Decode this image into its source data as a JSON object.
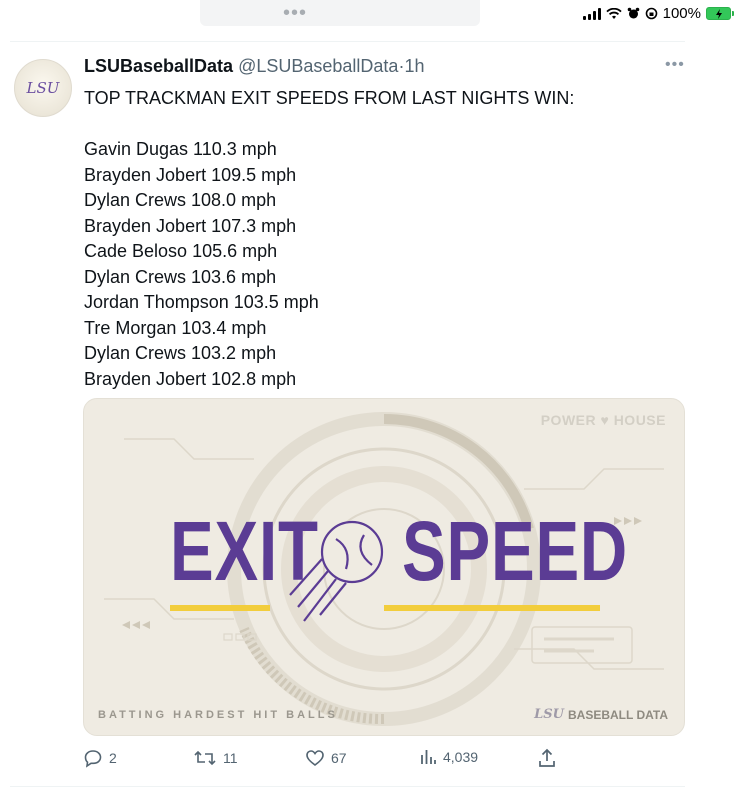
{
  "status_bar": {
    "battery_text": "100%",
    "dots": "•••",
    "colors": {
      "battery": "#33c759"
    }
  },
  "tweet": {
    "author_name": "LSUBaseballData",
    "handle": "@LSUBaseballData",
    "separator": "·",
    "time": "1h",
    "more_label": "•••",
    "avatar_text": "LSU",
    "headline": "TOP TRACKMAN EXIT SPEEDS FROM LAST NIGHTS WIN:",
    "lines": [
      "Gavin Dugas 110.3 mph",
      "Brayden Jobert 109.5 mph",
      "Dylan Crews 108.0 mph",
      "Brayden Jobert 107.3 mph",
      "Cade Beloso 105.6 mph",
      "Dylan Crews 103.6 mph",
      "Jordan Thompson 103.5 mph",
      "Tre Morgan 103.4 mph",
      "Dylan Crews 103.2 mph",
      "Brayden Jobert 102.8 mph"
    ],
    "media": {
      "brand": "POWER ♥ HOUSE",
      "word_left": "EXIT",
      "word_right": "SPEED",
      "footer_left": "BATTING HARDEST HIT BALLS",
      "footer_mark": "LSU",
      "footer_right": "BASEBALL DATA",
      "colors": {
        "title": "#5b3c94",
        "accent": "#f2cd3c",
        "background": "#efebe2"
      }
    },
    "actions": {
      "replies": "2",
      "retweets": "11",
      "likes": "67",
      "views": "4,039"
    }
  }
}
